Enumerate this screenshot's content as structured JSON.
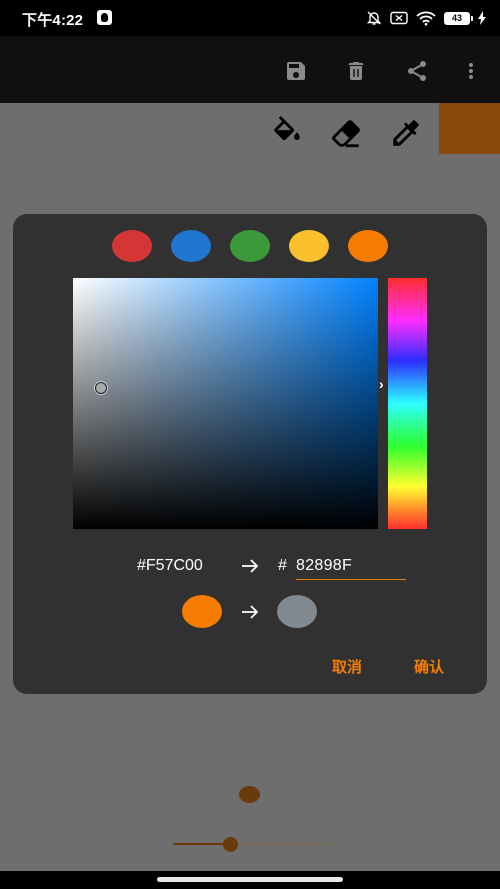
{
  "status_bar": {
    "time": "下午4:22",
    "battery": "43",
    "icons": [
      "qq-icon",
      "bell-off-icon",
      "sim-off-icon",
      "wifi-icon",
      "battery-icon",
      "charging-icon"
    ]
  },
  "toolbar": {
    "actions": [
      "save-icon",
      "delete-icon",
      "share-icon",
      "more-vert-icon"
    ]
  },
  "tools": {
    "items": [
      "paint-bucket-icon",
      "eraser-icon",
      "eyedropper-icon"
    ],
    "current_color": "#8a4a0e"
  },
  "color_picker": {
    "presets": [
      "#d63535",
      "#1f77d2",
      "#3a9a3a",
      "#fbc02d",
      "#f57c00"
    ],
    "hue_color": "#0082ff",
    "old_hex": "#F57C00",
    "hex_prefix": "#",
    "new_hex_value": "82898F",
    "old_color": "#f57c00",
    "new_color": "#82898f",
    "cancel_label": "取消",
    "confirm_label": "确认"
  },
  "brush": {
    "size_fraction": 0.37,
    "color": "#6b3a0a"
  }
}
